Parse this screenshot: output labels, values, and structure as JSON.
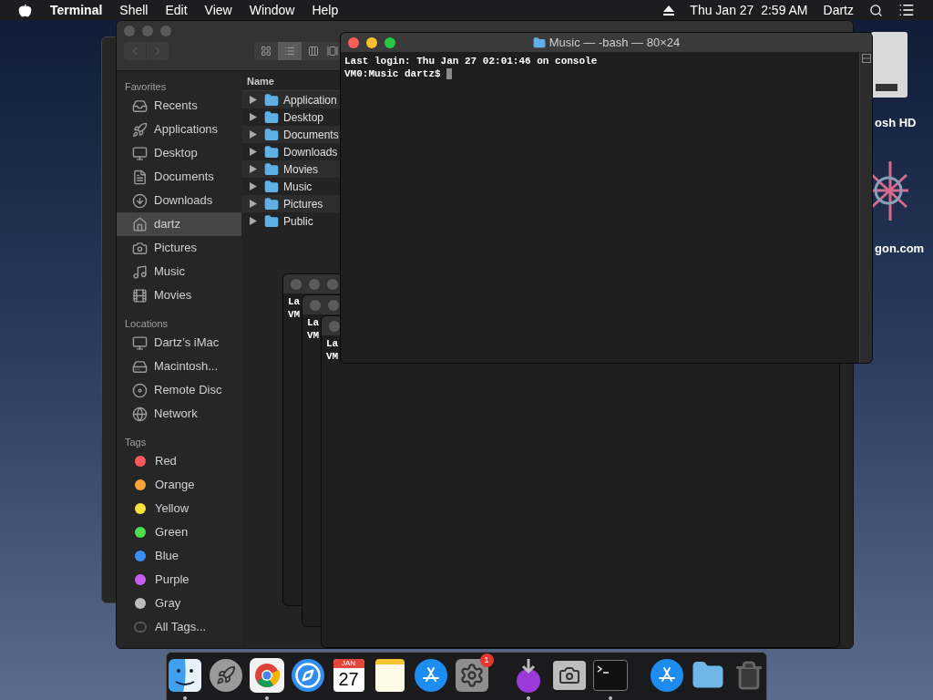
{
  "menubar": {
    "app": "Terminal",
    "menus": [
      "Shell",
      "Edit",
      "View",
      "Window",
      "Help"
    ],
    "clock": "Thu Jan 27  2:59 AM",
    "user": "Dartz"
  },
  "desktop_icons": [
    {
      "kind": "drive",
      "label": "osh HD"
    },
    {
      "kind": "emblem",
      "label": "gon.com"
    }
  ],
  "finder": {
    "views": [
      {
        "kind": "icons",
        "selected": false
      },
      {
        "kind": "list",
        "selected": true
      },
      {
        "kind": "columns",
        "selected": false
      },
      {
        "kind": "gallery",
        "selected": false
      }
    ],
    "sidebar": [
      {
        "title": "Favorites",
        "items": [
          {
            "kind": "recents",
            "label": "Recents",
            "selected": false
          },
          {
            "kind": "applications",
            "label": "Applications",
            "selected": false
          },
          {
            "kind": "desktop",
            "label": "Desktop",
            "selected": false
          },
          {
            "kind": "documents",
            "label": "Documents",
            "selected": false
          },
          {
            "kind": "downloads",
            "label": "Downloads",
            "selected": false
          },
          {
            "kind": "home",
            "label": "dartz",
            "selected": true
          },
          {
            "kind": "pictures",
            "label": "Pictures",
            "selected": false
          },
          {
            "kind": "music",
            "label": "Music",
            "selected": false
          },
          {
            "kind": "movies",
            "label": "Movies",
            "selected": false
          }
        ]
      },
      {
        "title": "Locations",
        "items": [
          {
            "kind": "computer",
            "label": "Dartz’s iMac",
            "selected": false
          },
          {
            "kind": "disk",
            "label": "Macintosh...",
            "selected": false
          },
          {
            "kind": "disc",
            "label": "Remote Disc",
            "selected": false
          },
          {
            "kind": "network",
            "label": "Network",
            "selected": false
          }
        ]
      },
      {
        "title": "Tags",
        "items": [
          {
            "kind": "tag",
            "label": "Red",
            "color": "#fc5a5a",
            "selected": false
          },
          {
            "kind": "tag",
            "label": "Orange",
            "color": "#f9a43a",
            "selected": false
          },
          {
            "kind": "tag",
            "label": "Yellow",
            "color": "#f5e33a",
            "selected": false
          },
          {
            "kind": "tag",
            "label": "Green",
            "color": "#4fde4f",
            "selected": false
          },
          {
            "kind": "tag",
            "label": "Blue",
            "color": "#3d8ff5",
            "selected": false
          },
          {
            "kind": "tag",
            "label": "Purple",
            "color": "#c55ef0",
            "selected": false
          },
          {
            "kind": "tag",
            "label": "Gray",
            "color": "#bdbdbd",
            "selected": false
          },
          {
            "kind": "all",
            "label": "All Tags...",
            "selected": false
          }
        ]
      }
    ],
    "column": "Name",
    "rows": [
      "Application",
      "Desktop",
      "Documents",
      "Downloads",
      "Movies",
      "Music",
      "Pictures",
      "Public"
    ]
  },
  "stacked_windows": [
    {
      "lines": [
        "La",
        "VM"
      ]
    },
    {
      "lines": [
        "La",
        "VM"
      ]
    },
    {
      "lines": [
        "La",
        "VM"
      ]
    }
  ],
  "terminal": {
    "title": "Music — -bash — 80×24",
    "lines": [
      "Last login: Thu Jan 27 02:01:46 on console",
      "VM0:Music dartz$ "
    ]
  },
  "dock": [
    {
      "kind": "finder",
      "running": true
    },
    {
      "kind": "launchpad",
      "running": false
    },
    {
      "kind": "chrome",
      "running": true
    },
    {
      "kind": "safari",
      "running": false
    },
    {
      "kind": "calendar",
      "running": false,
      "month": "JAN",
      "day": "27"
    },
    {
      "kind": "notes",
      "running": false
    },
    {
      "kind": "appstore",
      "running": false
    },
    {
      "kind": "settings",
      "running": false,
      "badge": "1"
    },
    {
      "kind": "separator"
    },
    {
      "kind": "installer",
      "running": true
    },
    {
      "kind": "camera",
      "running": false
    },
    {
      "kind": "terminal",
      "running": true
    },
    {
      "kind": "separator"
    },
    {
      "kind": "appstore",
      "running": false
    },
    {
      "kind": "folder",
      "running": false
    },
    {
      "kind": "trash",
      "running": false
    }
  ]
}
